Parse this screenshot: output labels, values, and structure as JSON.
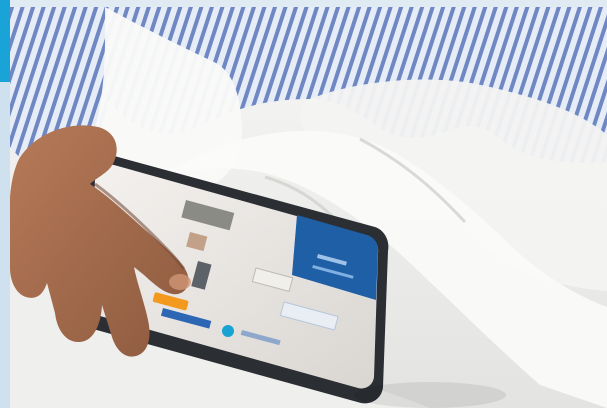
{
  "image": {
    "description_visible_text": [],
    "colors": {
      "accent": "#1aa3d6",
      "panel": "#dfeaf3",
      "tablet_blue": "#1f5fa6",
      "pajama_blue": "#6f88c4"
    }
  }
}
